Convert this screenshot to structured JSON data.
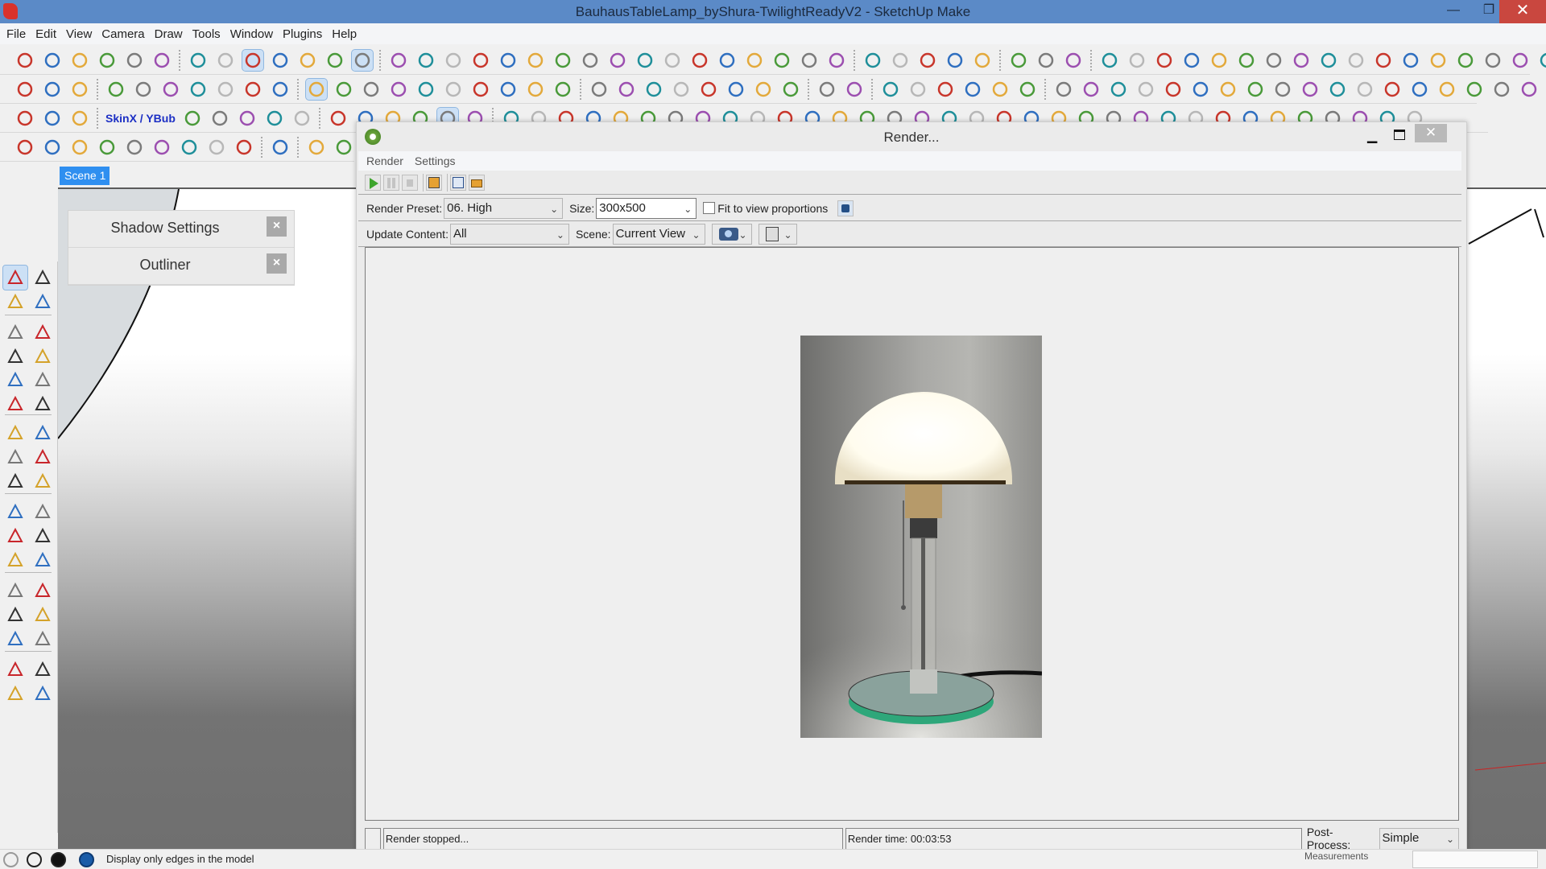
{
  "window": {
    "title": "BauhausTableLamp_byShura-TwilightReadyV2 - SketchUp Make",
    "controls": {
      "minimize": "—",
      "maximize": "❐",
      "close": "✕"
    }
  },
  "menu": [
    "File",
    "Edit",
    "View",
    "Camera",
    "Draw",
    "Tools",
    "Window",
    "Plugins",
    "Help"
  ],
  "toolbars": {
    "row1": [
      "podium-start-icon",
      "compass-icon",
      "shadow-sun-icon",
      "sketchy-icon",
      "paint-bucket-icon",
      "binoculars-icon",
      "xray-icon",
      "back-edges-icon",
      "wireframe-icon",
      "hidden-line-icon",
      "shaded-icon",
      "shaded-textures-icon",
      "monochrome-icon",
      "solid-union-icon",
      "solid-intersect-icon",
      "solid-outer-shell-icon",
      "solid-subtract-icon",
      "solid-trim-icon",
      "solid-split-icon",
      "sandbox-icons",
      "axes-icon",
      "tools-icon",
      "red-box-icon",
      "blue-box-icon",
      "gray-box-icon",
      "gradient-icon",
      "select-edge-icon",
      "bezier-curve-icons",
      "curve-tools-icons",
      "wrench-icon"
    ],
    "row2": [
      "iso-view-icon",
      "top-view-icon",
      "front-view-icon",
      "move-up-icons",
      "align-icon",
      "flip-icons",
      "cz-icon",
      "fredo-icons",
      "offset-icons",
      "loft-icons",
      "timer-icon",
      "surface-icons"
    ],
    "row3_label": "SkinX / YBub",
    "row4": [
      "spiral-icons",
      "helix-icon",
      "render-icons"
    ]
  },
  "scene_tab": "Scene 1",
  "trays": [
    {
      "label": "Shadow Settings",
      "close": "×"
    },
    {
      "label": "Outliner",
      "close": "×"
    }
  ],
  "palette": {
    "tools": [
      "select-icon",
      "make-component-icon",
      "paint-bucket-icon",
      "eraser-icon",
      "rectangle-icon",
      "pencil-line-icon",
      "circle-icon",
      "freehand-icon",
      "polygon-icon",
      "arc-icon",
      "pie-icon",
      "arc-2pt-icon",
      "move-icon",
      "push-pull-icon",
      "rotate-icon",
      "follow-me-icon",
      "scale-icon",
      "offset-icon",
      "tape-measure-icon",
      "dimension-icon",
      "protractor-icon",
      "text-icon",
      "axes-icon",
      "3d-text-icon",
      "orbit-icon",
      "pan-icon",
      "zoom-icon",
      "zoom-window-icon",
      "zoom-extents-icon",
      "previous-view-icon",
      "position-camera-icon",
      "look-around-icon",
      "walk-icon",
      "section-plane-icon"
    ]
  },
  "render_dialog": {
    "title": "Render...",
    "menu": [
      "Render",
      "Settings"
    ],
    "tools": [
      "start-render",
      "pause-render",
      "stop-render",
      "save-image",
      "copy-image",
      "export"
    ],
    "preset_label": "Render Preset:",
    "preset_value": "06. High",
    "size_label": "Size:",
    "size_value": "300x500",
    "fit_label": "Fit to view proportions",
    "fit_checked": false,
    "update_label": "Update Content:",
    "update_value": "All",
    "scene_label": "Scene:",
    "scene_value": "Current View",
    "status_text": "Render stopped...",
    "render_time": "Render time: 00:03:53",
    "postprocess_label": "Post-Process:",
    "postprocess_value": "Simple",
    "render_image_alt": "Bauhaus table lamp render"
  },
  "statusbar": {
    "icons": [
      "geo-location-icon",
      "credits-icon",
      "user-account-icon",
      "help-icon"
    ],
    "hint": "Display only edges in the model",
    "measurements_label": "Measurements"
  }
}
